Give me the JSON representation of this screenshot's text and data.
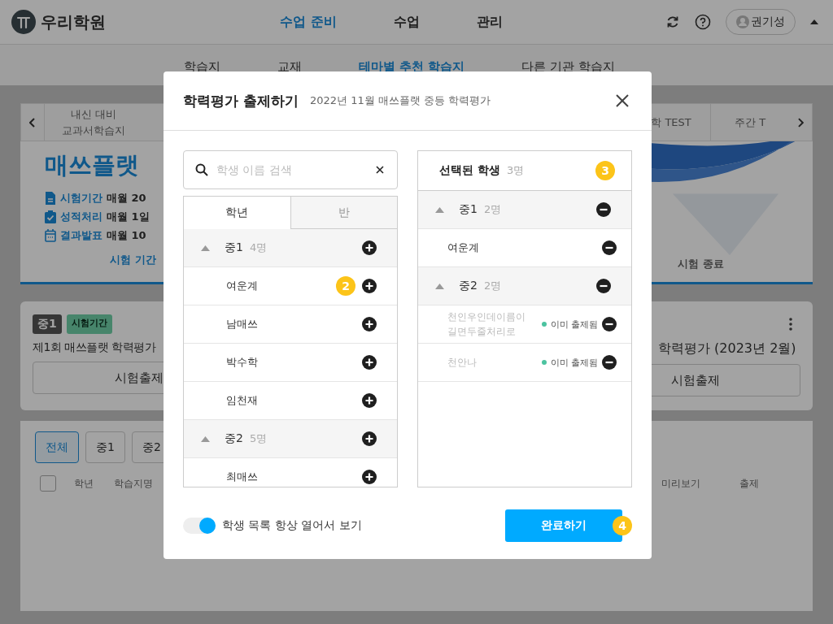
{
  "header": {
    "logo": "우리학원",
    "nav": [
      {
        "label": "수업 준비",
        "selected": true
      },
      {
        "label": "수업",
        "selected": false
      },
      {
        "label": "관리",
        "selected": false
      }
    ],
    "user": "권기성"
  },
  "subnav": [
    {
      "label": "학습지",
      "selected": false
    },
    {
      "label": "교재",
      "selected": false
    },
    {
      "label": "테마별 추천 학습지",
      "selected": true
    },
    {
      "label": "다른 기관 학습지",
      "selected": false
    }
  ],
  "content_tabs": {
    "left": [
      "내신 대비 교과서학습지"
    ],
    "right": [
      "학 TEST",
      "주간 T"
    ]
  },
  "banner": {
    "title": "매쓰플랫",
    "info": [
      {
        "label": "시험기간",
        "value": "매월 20"
      },
      {
        "label": "성적처리",
        "value": "매월 1일"
      },
      {
        "label": "결과발표",
        "value": "매월 10"
      }
    ],
    "timeline": [
      {
        "label": "시험 기간",
        "selected": true
      },
      {
        "label": "시험 종료",
        "selected": false
      }
    ]
  },
  "exam_cards": [
    {
      "badges": [
        {
          "label": "중1",
          "kind": "grade"
        },
        {
          "label": "시험기간",
          "kind": "status"
        }
      ],
      "title": "제1회 매쓰플랫 학력평가",
      "button": "시험출제"
    },
    {
      "title": "학력평가 (2023년 2월)",
      "button": "시험출제"
    }
  ],
  "worksheet_list": {
    "filters": [
      {
        "label": "전체",
        "selected": true
      },
      {
        "label": "중1",
        "selected": false
      },
      {
        "label": "중2",
        "selected": false
      }
    ],
    "select_all": {
      "checked": false
    },
    "columns_left": [
      "학년",
      "학습지명"
    ],
    "columns_right": [
      "미리보기",
      "출제"
    ]
  },
  "modal": {
    "title": "학력평가 출제하기",
    "subtitle": "2022년 11월 매쓰플랫 중등 학력평가",
    "search": {
      "placeholder": "학생 이름 검색"
    },
    "tabs": [
      {
        "label": "학년",
        "selected": true
      },
      {
        "label": "반",
        "selected": false
      }
    ],
    "student_groups": [
      {
        "name": "중1",
        "count": "4명",
        "expanded": true,
        "students": [
          {
            "name": "여운계",
            "step": "2"
          },
          {
            "name": "남매쓰"
          },
          {
            "name": "박수학"
          },
          {
            "name": "임천재"
          }
        ]
      },
      {
        "name": "중2",
        "count": "5명",
        "expanded": true,
        "students": [
          {
            "name": "최매쓰"
          }
        ]
      }
    ],
    "selected_panel": {
      "title": "선택된 학생",
      "count": "3명",
      "step": "3",
      "groups": [
        {
          "name": "중1",
          "count": "2명",
          "expanded": true,
          "students": [
            {
              "name": "여운계",
              "disabled": false
            }
          ]
        },
        {
          "name": "중2",
          "count": "2명",
          "expanded": true,
          "students": [
            {
              "name": "천인우인데이름이 길면두줄처리로",
              "disabled": true,
              "status": "이미 출제됨",
              "color": "#4cc3a0"
            },
            {
              "name": "천안나",
              "disabled": true,
              "status": "이미 출제됨",
              "color": "#4cc3a0"
            }
          ]
        }
      ]
    },
    "toggle": {
      "label": "학생 목록 항상 열어서 보기",
      "on": true
    },
    "confirm_button": "완료하기",
    "confirm_step": "4"
  }
}
